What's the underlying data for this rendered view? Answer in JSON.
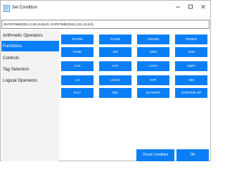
{
  "window": {
    "title": "Set Condition",
    "controls": [
      "minimize-icon",
      "maximize-icon",
      "close-icon"
    ]
  },
  "expression": {
    "value": "(DATETIME(2021,2,28,15,50,0) -DATETIME(2021,2,21,23,0,0)"
  },
  "sidebar": {
    "items": [
      {
        "label": "Arithmetic Operators"
      },
      {
        "label": "Functions"
      },
      {
        "label": "Controls"
      },
      {
        "label": "Tag Selection"
      },
      {
        "label": "Logical Operators"
      }
    ]
  },
  "functions": {
    "buttons": [
      "ROUND",
      "FLOOR",
      "CEILING",
      "POWER",
      "RAND",
      "SIN",
      "SINH",
      "ASIN",
      "COS",
      "COT",
      "COTH",
      "SQRT",
      "LN",
      "LOG10",
      "EXP",
      "ABS",
      "FACT",
      "SEC",
      "DATEDIFF",
      "DATETIME DIF"
    ]
  },
  "footer": {
    "check_label": "Check Condition",
    "ok_label": "OK"
  },
  "colors": {
    "accent": "#0a7ef5",
    "sidebar_bg": "#f3f3f3"
  }
}
